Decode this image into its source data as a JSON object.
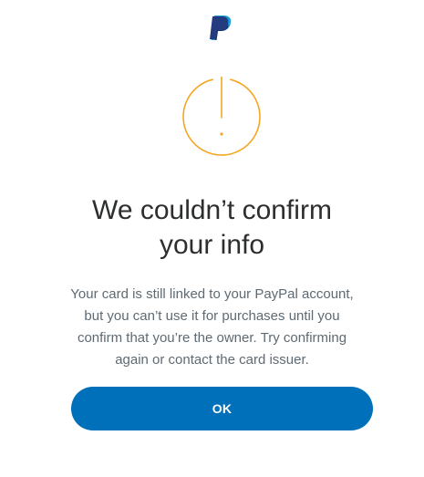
{
  "brand": {
    "logo_icon": "paypal-logo-icon",
    "colors": {
      "dark_blue": "#253b80",
      "light_blue": "#179bd7",
      "mid_blue": "#222d65"
    }
  },
  "alert": {
    "icon": "exclamation-circle-icon",
    "color": "#f5a623"
  },
  "dialog": {
    "title_line1": "We couldn’t confirm",
    "title_line2": "your info",
    "message_line1": "Your card is still linked to your PayPal account,",
    "message_line2": "but you can’t use it for purchases until you",
    "message_line3": "confirm that you’re the owner. Try confirming",
    "message_line4": "again or contact the card issuer."
  },
  "actions": {
    "ok_label": "OK",
    "button_color": "#0070ba"
  }
}
